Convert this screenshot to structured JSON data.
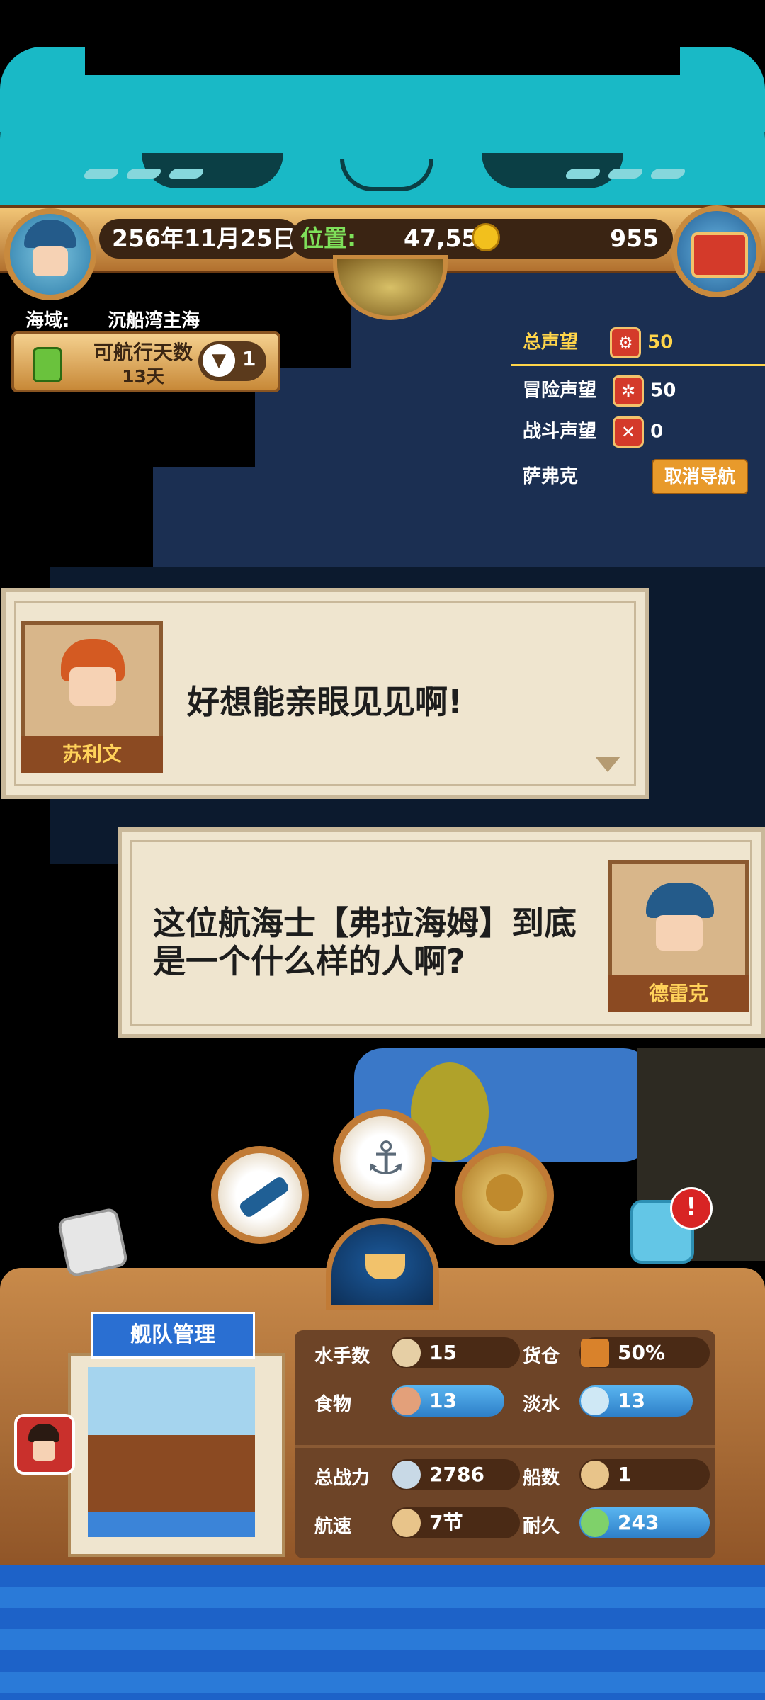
{
  "topbar": {
    "date": "256年11月25日",
    "position_label": "位置:",
    "position_value": "47,55",
    "gold": "955"
  },
  "sea_area": {
    "label": "海域:",
    "value": "沉船湾主海"
  },
  "sail_days": {
    "title": "可航行天数",
    "value": "13天",
    "count": "1"
  },
  "reputation": {
    "total_label": "总声望",
    "total_value": "50",
    "adventure_label": "冒险声望",
    "adventure_value": "50",
    "battle_label": "战斗声望",
    "battle_value": "0",
    "destination": "萨弗克",
    "cancel_nav": "取消导航"
  },
  "dialog1": {
    "speaker": "苏利文",
    "text": "好想能亲眼见见啊!"
  },
  "dialog2": {
    "speaker": "德雷克",
    "line1": "这位航海士【弗拉海姆】到底",
    "line2": "是一个什么样的人啊?"
  },
  "fleet": {
    "title": "舰队管理",
    "sailors_label": "水手数",
    "sailors_value": "15",
    "cargo_label": "货仓",
    "cargo_value": "50%",
    "food_label": "食物",
    "food_value": "13",
    "water_label": "淡水",
    "water_value": "13",
    "power_label": "总战力",
    "power_value": "2786",
    "ships_label": "船数",
    "ships_value": "1",
    "speed_label": "航速",
    "speed_value": "7节",
    "durability_label": "耐久",
    "durability_value": "243"
  },
  "icons": {
    "alert": "!"
  }
}
